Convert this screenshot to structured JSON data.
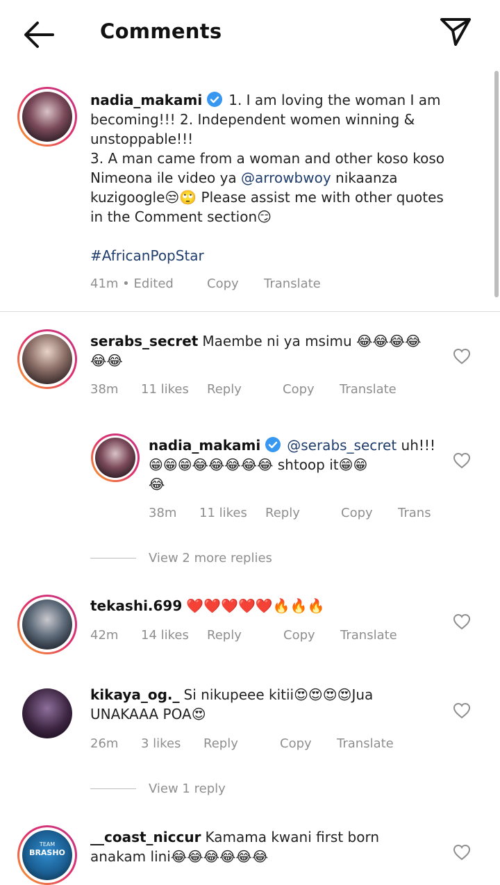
{
  "header": {
    "title": "Comments",
    "back_icon": "arrow-left-icon",
    "send_icon": "paper-plane-icon"
  },
  "caption": {
    "username": "nadia_makami",
    "line1": "1. I am loving the woman I am",
    "line2": "becoming!!! 2. Independent women winning &",
    "line3": "unstoppable!!!",
    "line4": "3. A man came from a woman and other koso koso",
    "line5_pre": "Nimeona ile video ya ",
    "line5_mention": "@arrowbwoy",
    "line5_post": " nikaanza",
    "line6": "kuzigoogle😒🙄 Please assist me with other quotes",
    "line7": "in the Comment section😏",
    "hashtag": "#AfricanPopStar",
    "time": "41m • Edited",
    "copy": "Copy",
    "translate": "Translate"
  },
  "comments": [
    {
      "username": "serabs_secret",
      "line1": "Maembe ni ya msimu 😂😂😂😂",
      "line2": "😂😂",
      "time": "38m",
      "likes": "11 likes",
      "reply": "Reply",
      "copy": "Copy",
      "translate": "Translate"
    },
    {
      "username": "nadia_makami",
      "mention": "@serabs_secret",
      "line1_post": " uh!!!",
      "line2": "😁😁😁😂😂😂😂😂 shtoop it😁😁",
      "line3": "😂",
      "time": "38m",
      "likes": "11 likes",
      "reply": "Reply",
      "copy": "Copy",
      "translate": "Trans",
      "view_more": "View 2 more replies"
    },
    {
      "username": "tekashi.699",
      "line1": "❤️❤️❤️❤️❤️🔥🔥🔥",
      "time": "42m",
      "likes": "14 likes",
      "reply": "Reply",
      "copy": "Copy",
      "translate": "Translate"
    },
    {
      "username": "kikaya_og._",
      "line1": "Si nikupeee kitii😍😍😍😍Jua",
      "line2": "UNAKAAA POA😍",
      "time": "26m",
      "likes": "3 likes",
      "reply": "Reply",
      "copy": "Copy",
      "translate": "Translate",
      "view_more": "View 1 reply"
    },
    {
      "username": "__coast_niccur",
      "line1": "Kamama kwani first born",
      "line2": "anakam lini😂😂😂😂😂😂",
      "avatar_text_top": "TEAM",
      "avatar_text": "BRASHO"
    }
  ],
  "colors": {
    "accent": "#3897f0",
    "mention": "#1f3d6d",
    "muted": "#8e8e8e"
  }
}
